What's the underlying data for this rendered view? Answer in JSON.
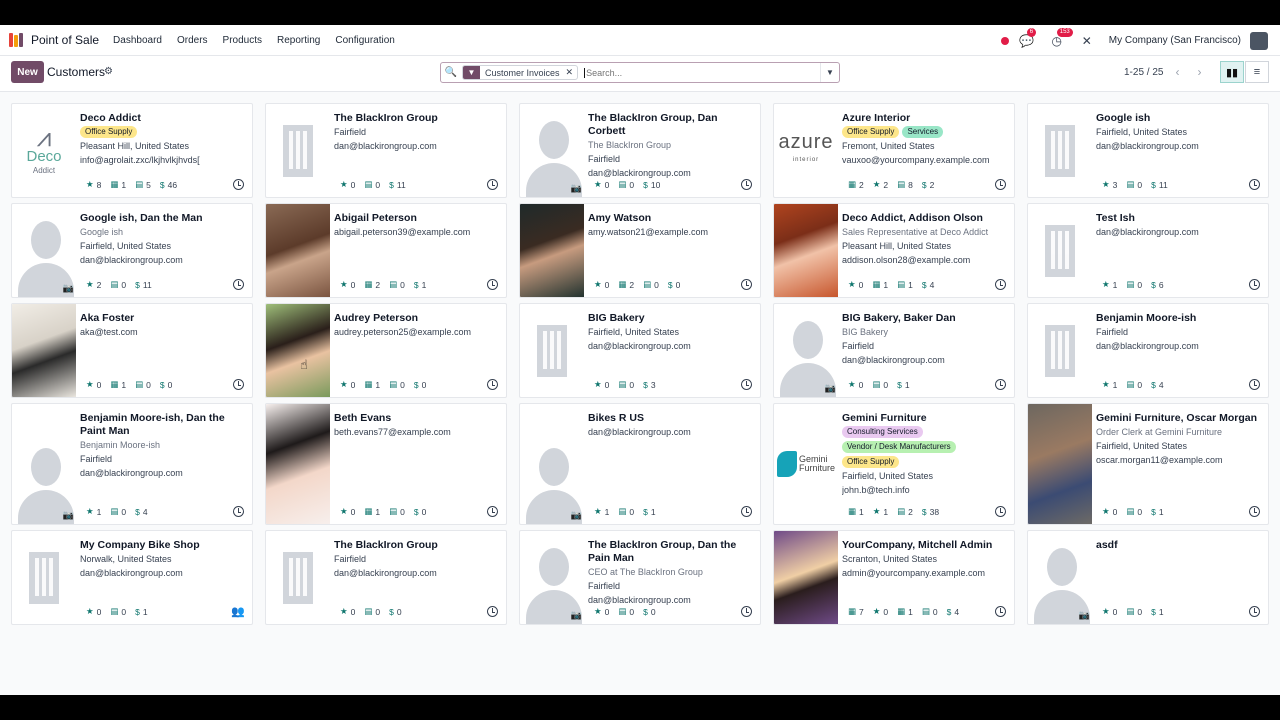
{
  "navbar": {
    "app_name": "Point of Sale",
    "menu": [
      "Dashboard",
      "Orders",
      "Products",
      "Reporting",
      "Configuration"
    ],
    "chat_badge": "6",
    "activity_badge": "153",
    "company": "My Company (San Francisco)"
  },
  "control": {
    "new_label": "New",
    "breadcrumb": "Customers",
    "facet_label": "Customer Invoices",
    "search_placeholder": "Search...",
    "pager": "1-25 / 25"
  },
  "colors": {
    "brand": "#714b67",
    "accent": "#0f766e",
    "tag_yellow": "#fde68a",
    "tag_teal": "#99e6c7",
    "tag_purple": "#e9c9f0",
    "tag_green": "#b7f0b1"
  },
  "cards": [
    {
      "name": "Deco Addict",
      "img": "logo-deco",
      "tags": [
        {
          "t": "Office Supply",
          "c": "#fde68a"
        }
      ],
      "lines": [
        "Pleasant Hill, United States",
        "info@agrolait.zxc/lkjhvlkjhvds["
      ],
      "muted": [],
      "stats": [
        [
          "★",
          "8"
        ],
        [
          "▦",
          "1"
        ],
        [
          "▤",
          "5"
        ],
        [
          "$",
          "46"
        ]
      ]
    },
    {
      "name": "The BlackIron Group",
      "img": "building",
      "tags": [],
      "lines": [
        "Fairfield",
        "dan@blackirongroup.com"
      ],
      "muted": [],
      "stats": [
        [
          "★",
          "0"
        ],
        [
          "▤",
          "0"
        ],
        [
          "$",
          "11"
        ]
      ]
    },
    {
      "name": "The BlackIron Group, Dan Corbett",
      "img": "person",
      "tags": [],
      "lines": [
        "The BlackIron Group",
        "Fairfield",
        "dan@blackirongroup.com"
      ],
      "muted": [
        0
      ],
      "stats": [
        [
          "★",
          "0"
        ],
        [
          "▤",
          "0"
        ],
        [
          "$",
          "10"
        ]
      ]
    },
    {
      "name": "Azure Interior",
      "img": "logo-azure",
      "tags": [
        {
          "t": "Office Supply",
          "c": "#fde68a"
        },
        {
          "t": "Services",
          "c": "#99e6c7"
        }
      ],
      "lines": [
        "Fremont, United States",
        "vauxoo@yourcompany.example.com"
      ],
      "muted": [],
      "stats": [
        [
          "▦",
          "2"
        ],
        [
          "★",
          "2"
        ],
        [
          "▤",
          "8"
        ],
        [
          "$",
          "2"
        ]
      ]
    },
    {
      "name": "Google ish",
      "img": "building",
      "tags": [],
      "lines": [
        "Fairfield, United States",
        "dan@blackirongroup.com"
      ],
      "muted": [],
      "stats": [
        [
          "★",
          "3"
        ],
        [
          "▤",
          "0"
        ],
        [
          "$",
          "11"
        ]
      ]
    },
    {
      "name": "Google ish, Dan the Man",
      "img": "person",
      "tags": [],
      "lines": [
        "Google ish",
        "Fairfield, United States",
        "dan@blackirongroup.com"
      ],
      "muted": [
        0
      ],
      "stats": [
        [
          "★",
          "2"
        ],
        [
          "▤",
          "0"
        ],
        [
          "$",
          "11"
        ]
      ]
    },
    {
      "name": "Abigail Peterson",
      "img": "photo1",
      "tags": [],
      "lines": [
        "abigail.peterson39@example.com"
      ],
      "muted": [],
      "stats": [
        [
          "★",
          "0"
        ],
        [
          "▦",
          "2"
        ],
        [
          "▤",
          "0"
        ],
        [
          "$",
          "1"
        ]
      ]
    },
    {
      "name": "Amy Watson",
      "img": "photo2",
      "tags": [],
      "lines": [
        "amy.watson21@example.com"
      ],
      "muted": [],
      "stats": [
        [
          "★",
          "0"
        ],
        [
          "▦",
          "2"
        ],
        [
          "▤",
          "0"
        ],
        [
          "$",
          "0"
        ]
      ]
    },
    {
      "name": "Deco Addict, Addison Olson",
      "img": "photo3",
      "tags": [],
      "lines": [
        "Sales Representative at Deco Addict",
        "Pleasant Hill, United States",
        "addison.olson28@example.com"
      ],
      "muted": [
        0
      ],
      "stats": [
        [
          "★",
          "0"
        ],
        [
          "▦",
          "1"
        ],
        [
          "▤",
          "1"
        ],
        [
          "$",
          "4"
        ]
      ]
    },
    {
      "name": "Test Ish",
      "img": "building",
      "tags": [],
      "lines": [
        "dan@blackirongroup.com"
      ],
      "muted": [],
      "stats": [
        [
          "★",
          "1"
        ],
        [
          "▤",
          "0"
        ],
        [
          "$",
          "6"
        ]
      ]
    },
    {
      "name": "Aka Foster",
      "img": "photo4",
      "tags": [],
      "lines": [
        "aka@test.com"
      ],
      "muted": [],
      "stats": [
        [
          "★",
          "0"
        ],
        [
          "▦",
          "1"
        ],
        [
          "▤",
          "0"
        ],
        [
          "$",
          "0"
        ]
      ]
    },
    {
      "name": "Audrey Peterson",
      "img": "photo5",
      "tags": [],
      "lines": [
        "audrey.peterson25@example.com"
      ],
      "muted": [],
      "stats": [
        [
          "★",
          "0"
        ],
        [
          "▦",
          "1"
        ],
        [
          "▤",
          "0"
        ],
        [
          "$",
          "0"
        ]
      ]
    },
    {
      "name": "BIG Bakery",
      "img": "building",
      "tags": [],
      "lines": [
        "Fairfield, United States",
        "dan@blackirongroup.com"
      ],
      "muted": [],
      "stats": [
        [
          "★",
          "0"
        ],
        [
          "▤",
          "0"
        ],
        [
          "$",
          "3"
        ]
      ]
    },
    {
      "name": "BIG Bakery, Baker Dan",
      "img": "person",
      "tags": [],
      "lines": [
        "BIG Bakery",
        "Fairfield",
        "dan@blackirongroup.com"
      ],
      "muted": [
        0
      ],
      "stats": [
        [
          "★",
          "0"
        ],
        [
          "▤",
          "0"
        ],
        [
          "$",
          "1"
        ]
      ]
    },
    {
      "name": "Benjamin Moore-ish",
      "img": "building",
      "tags": [],
      "lines": [
        "Fairfield",
        "dan@blackirongroup.com"
      ],
      "muted": [],
      "stats": [
        [
          "★",
          "1"
        ],
        [
          "▤",
          "0"
        ],
        [
          "$",
          "4"
        ]
      ]
    },
    {
      "name": "Benjamin Moore-ish, Dan the Paint Man",
      "img": "person",
      "tags": [],
      "lines": [
        "Benjamin Moore-ish",
        "Fairfield",
        "dan@blackirongroup.com"
      ],
      "muted": [
        0
      ],
      "stats": [
        [
          "★",
          "1"
        ],
        [
          "▤",
          "0"
        ],
        [
          "$",
          "4"
        ]
      ]
    },
    {
      "name": "Beth Evans",
      "img": "photo6",
      "tags": [],
      "lines": [
        "beth.evans77@example.com"
      ],
      "muted": [],
      "stats": [
        [
          "★",
          "0"
        ],
        [
          "▦",
          "1"
        ],
        [
          "▤",
          "0"
        ],
        [
          "$",
          "0"
        ]
      ]
    },
    {
      "name": "Bikes R US",
      "img": "person",
      "tags": [],
      "lines": [
        "dan@blackirongroup.com"
      ],
      "muted": [],
      "stats": [
        [
          "★",
          "1"
        ],
        [
          "▤",
          "0"
        ],
        [
          "$",
          "1"
        ]
      ]
    },
    {
      "name": "Gemini Furniture",
      "img": "logo-gemini",
      "tags": [
        {
          "t": "Consulting Services",
          "c": "#e9c9f0"
        },
        {
          "t": "Vendor / Desk Manufacturers",
          "c": "#b7f0b1"
        },
        {
          "t": "Office Supply",
          "c": "#fde68a"
        }
      ],
      "lines": [
        "Fairfield, United States",
        "john.b@tech.info"
      ],
      "muted": [],
      "stats": [
        [
          "▦",
          "1"
        ],
        [
          "★",
          "1"
        ],
        [
          "▤",
          "2"
        ],
        [
          "$",
          "38"
        ]
      ]
    },
    {
      "name": "Gemini Furniture, Oscar Morgan",
      "img": "photo7",
      "tags": [],
      "lines": [
        "Order Clerk at Gemini Furniture",
        "Fairfield, United States",
        "oscar.morgan11@example.com"
      ],
      "muted": [
        0
      ],
      "stats": [
        [
          "★",
          "0"
        ],
        [
          "▤",
          "0"
        ],
        [
          "$",
          "1"
        ]
      ]
    },
    {
      "name": "My Company Bike Shop",
      "img": "building",
      "tags": [],
      "lines": [
        "Norwalk, United States",
        "dan@blackirongroup.com"
      ],
      "muted": [],
      "stats": [
        [
          "★",
          "0"
        ],
        [
          "▤",
          "0"
        ],
        [
          "$",
          "1"
        ]
      ],
      "people": true
    },
    {
      "name": "The BlackIron Group",
      "img": "building",
      "tags": [],
      "lines": [
        "Fairfield",
        "dan@blackirongroup.com"
      ],
      "muted": [],
      "stats": [
        [
          "★",
          "0"
        ],
        [
          "▤",
          "0"
        ],
        [
          "$",
          "0"
        ]
      ]
    },
    {
      "name": "The BlackIron Group, Dan the Pain Man",
      "img": "person",
      "tags": [],
      "lines": [
        "CEO at The BlackIron Group",
        "Fairfield",
        "dan@blackirongroup.com"
      ],
      "muted": [
        0
      ],
      "stats": [
        [
          "★",
          "0"
        ],
        [
          "▤",
          "0"
        ],
        [
          "$",
          "0"
        ]
      ]
    },
    {
      "name": "YourCompany, Mitchell Admin",
      "img": "photo8",
      "tags": [],
      "lines": [
        "Scranton, United States",
        "admin@yourcompany.example.com"
      ],
      "muted": [],
      "stats": [
        [
          "▦",
          "7"
        ],
        [
          "★",
          "0"
        ],
        [
          "▦",
          "1"
        ],
        [
          "▤",
          "0"
        ],
        [
          "$",
          "4"
        ]
      ]
    },
    {
      "name": "asdf",
      "img": "person",
      "tags": [],
      "lines": [],
      "muted": [],
      "stats": [
        [
          "★",
          "0"
        ],
        [
          "▤",
          "0"
        ],
        [
          "$",
          "1"
        ]
      ]
    }
  ]
}
